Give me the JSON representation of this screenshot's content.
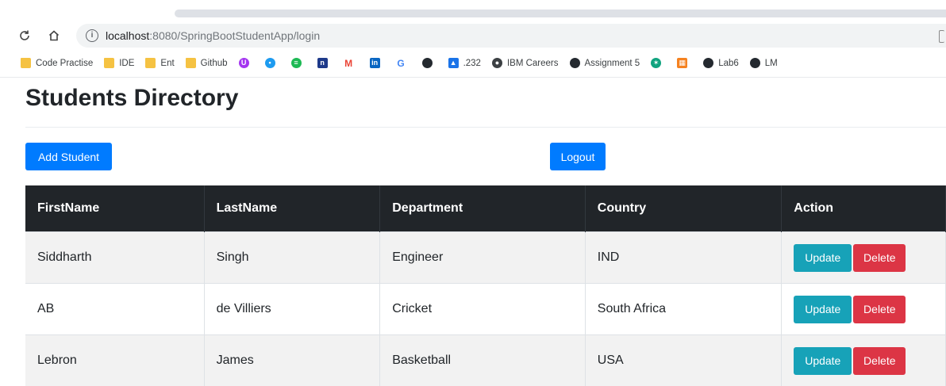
{
  "browser": {
    "url_host": "localhost",
    "url_path": ":8080/SpringBootStudentApp/login",
    "bookmarks": [
      {
        "label": "Code Practise",
        "icon": "folder-icon",
        "color": "#f5c242"
      },
      {
        "label": "IDE",
        "icon": "folder-icon",
        "color": "#f5c242"
      },
      {
        "label": "Ent",
        "icon": "folder-icon",
        "color": "#f5c242"
      },
      {
        "label": "Github",
        "icon": "folder-icon",
        "color": "#f5c242"
      },
      {
        "label": "",
        "icon": "udemy-icon",
        "color": "#a435f0"
      },
      {
        "label": "",
        "icon": "twitter-icon",
        "color": "#1d9bf0"
      },
      {
        "label": "",
        "icon": "spotify-icon",
        "color": "#1db954"
      },
      {
        "label": "",
        "icon": "naukri-icon",
        "color": "#1e3a8a"
      },
      {
        "label": "",
        "icon": "gmail-icon",
        "color": "#ea4335"
      },
      {
        "label": "",
        "icon": "linkedin-icon",
        "color": "#0a66c2"
      },
      {
        "label": "",
        "icon": "google-icon",
        "color": "#4285f4"
      },
      {
        "label": "",
        "icon": "github-icon",
        "color": "#24292f"
      },
      {
        "label": ".232",
        "icon": "app-icon",
        "color": "#1a73e8"
      },
      {
        "label": "IBM Careers",
        "icon": "globe-icon",
        "color": "#3c4043"
      },
      {
        "label": "Assignment 5",
        "icon": "github-icon",
        "color": "#24292f"
      },
      {
        "label": "",
        "icon": "chatgpt-icon",
        "color": "#10a37f"
      },
      {
        "label": "",
        "icon": "grid-app-icon",
        "color": "#f58220"
      },
      {
        "label": "Lab6",
        "icon": "github-icon",
        "color": "#24292f"
      },
      {
        "label": "LM",
        "icon": "github-icon",
        "color": "#24292f"
      }
    ]
  },
  "page": {
    "title": "Students Directory",
    "add_label": "Add Student",
    "logout_label": "Logout"
  },
  "table": {
    "headers": [
      "FirstName",
      "LastName",
      "Department",
      "Country",
      "Action"
    ],
    "rows": [
      {
        "first": "Siddharth",
        "last": "Singh",
        "department": "Engineer",
        "country": "IND"
      },
      {
        "first": "AB",
        "last": "de Villiers",
        "department": "Cricket",
        "country": "South Africa"
      },
      {
        "first": "Lebron",
        "last": "James",
        "department": "Basketball",
        "country": "USA"
      }
    ],
    "update_label": "Update",
    "delete_label": "Delete"
  },
  "colors": {
    "primary": "#007bff",
    "info": "#17a2b8",
    "danger": "#dc3545",
    "table_header": "#212529"
  }
}
